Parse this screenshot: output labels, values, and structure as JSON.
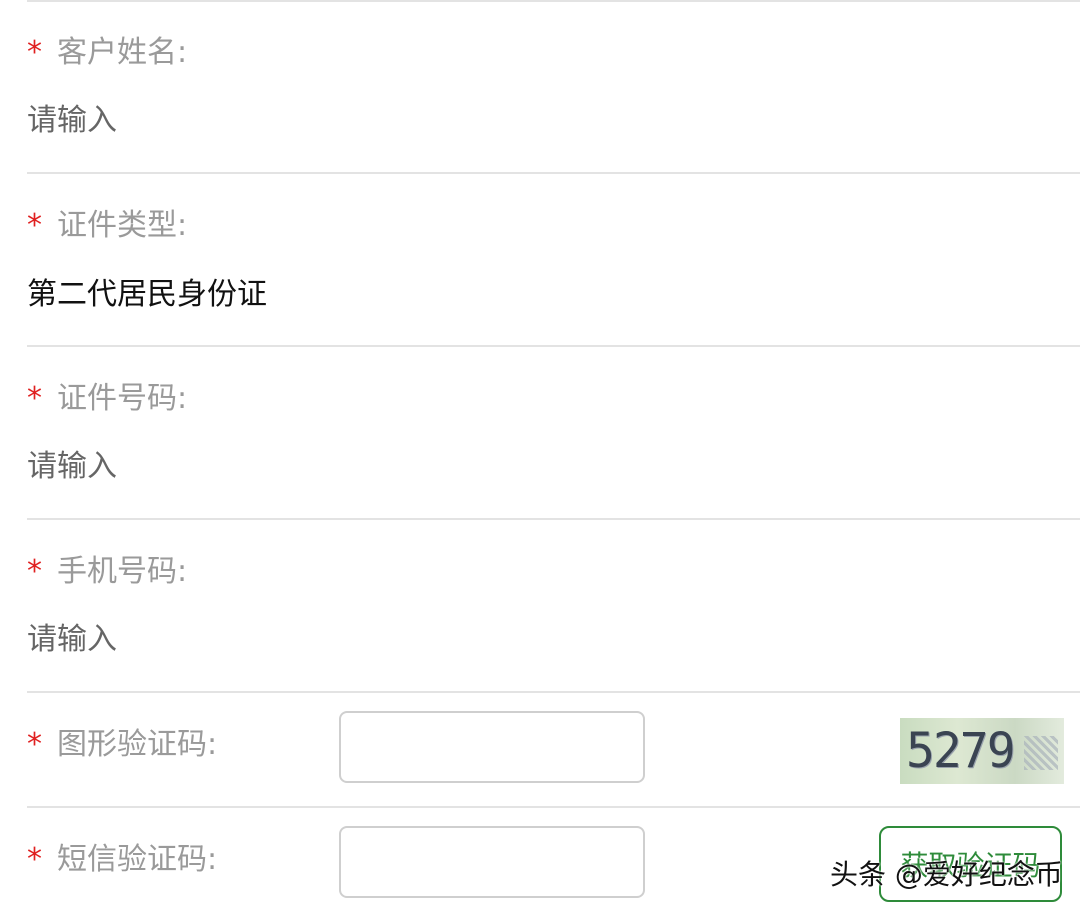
{
  "required_mark": "*",
  "fields": {
    "customer_name": {
      "label": "客户姓名:",
      "placeholder": "请输入"
    },
    "id_type": {
      "label": "证件类型:",
      "value": "第二代居民身份证"
    },
    "id_number": {
      "label": "证件号码:",
      "placeholder": "请输入"
    },
    "phone": {
      "label": "手机号码:",
      "placeholder": "请输入"
    },
    "image_captcha": {
      "label": "图形验证码:",
      "value": "",
      "captcha_text": "5279"
    },
    "sms_code": {
      "label": "短信验证码:",
      "value": "",
      "button_label": "获取验证码"
    }
  },
  "watermark": "头条 @爱好纪念币",
  "colors": {
    "required": "#e02020",
    "accent": "#2e8b3a",
    "label": "#9a9a9a"
  }
}
